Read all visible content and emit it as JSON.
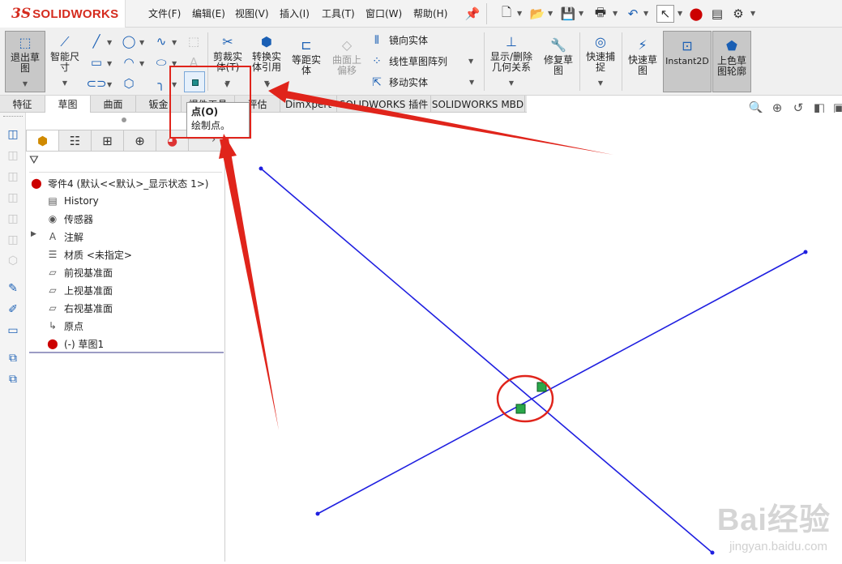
{
  "app": {
    "logo_prefix": "3S",
    "logo_name": "SOLIDWORKS"
  },
  "menu": [
    "文件(F)",
    "编辑(E)",
    "视图(V)",
    "插入(I)",
    "工具(T)",
    "窗口(W)",
    "帮助(H)"
  ],
  "ribbon": {
    "exit_sketch": "退出草图",
    "smart_dim": "智能尺寸",
    "trim": "剪裁实体(T)",
    "convert": "转换实体引用",
    "offset": "等距实体",
    "surface_offset": "曲面上偏移",
    "mirror": "镜向实体",
    "linear_pattern": "线性草图阵列",
    "move": "移动实体",
    "display_relations": "显示/删除几何关系",
    "repair": "修复草图",
    "quick_snap": "快速捕捉",
    "rapid_sketch": "快速草图",
    "instant2d": "Instant2D",
    "shaded_contours": "上色草图轮廓"
  },
  "tabs": [
    "特征",
    "草图",
    "曲面",
    "钣金",
    "焊件工具",
    "评估",
    "DimXpert",
    "SOLIDWORKS 插件",
    "SOLIDWORKS MBD"
  ],
  "tooltip": {
    "title": "点(O)",
    "desc": "绘制点。"
  },
  "tree": {
    "root": "零件4  (默认<<默认>_显示状态 1>)",
    "items": [
      "History",
      "传感器",
      "注解",
      "材质 <未指定>",
      "前视基准面",
      "上视基准面",
      "右视基准面",
      "原点",
      "(-) 草图1"
    ]
  },
  "watermark": {
    "brand": "Bai经验",
    "url": "jingyan.baidu.com"
  },
  "colors": {
    "sketch_line": "#1f1fe0",
    "annotation": "#e0241b",
    "logo": "#d52b1e"
  }
}
